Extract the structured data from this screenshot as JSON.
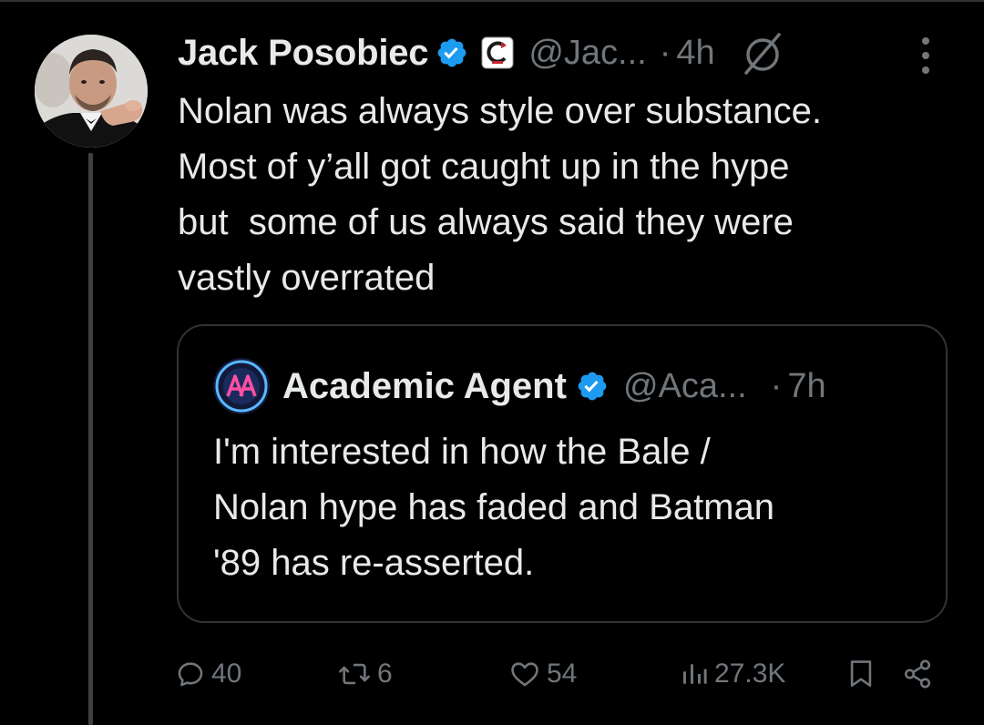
{
  "tweet": {
    "author": {
      "name": "Jack Posobiec",
      "handle": "@Jac...",
      "verified": true,
      "avatar": "profile-photo"
    },
    "dot": "·",
    "time": "4h",
    "text_lines": [
      "Nolan was always style over substance.",
      "Most of y’all got caught up in the hype",
      "but  some of us always said they were",
      "vastly overrated"
    ],
    "quoted": {
      "author": {
        "name": "Academic Agent",
        "handle": "@Aca...",
        "verified": true,
        "avatar": "academic-agent-logo"
      },
      "dot": "·",
      "time": "7h",
      "text_lines": [
        "I'm interested in how the Bale /",
        "Nolan hype has faded and Batman",
        "'89 has re-asserted."
      ]
    },
    "actions": {
      "replies": "40",
      "reposts": "6",
      "likes": "54",
      "views": "27.3K"
    }
  },
  "icons": {
    "verified": "verified-badge-icon",
    "affiliation": "affiliation-badge-icon",
    "grok": "grok-icon",
    "more": "more-vertical-icon",
    "reply": "reply-icon",
    "repost": "repost-icon",
    "like": "like-icon",
    "views": "views-icon",
    "bookmark": "bookmark-icon",
    "share": "share-icon"
  },
  "colors": {
    "background": "#000000",
    "text": "#e7e9ea",
    "muted": "#71767b",
    "border": "#2f3336",
    "verified": "#1d9bf0"
  }
}
